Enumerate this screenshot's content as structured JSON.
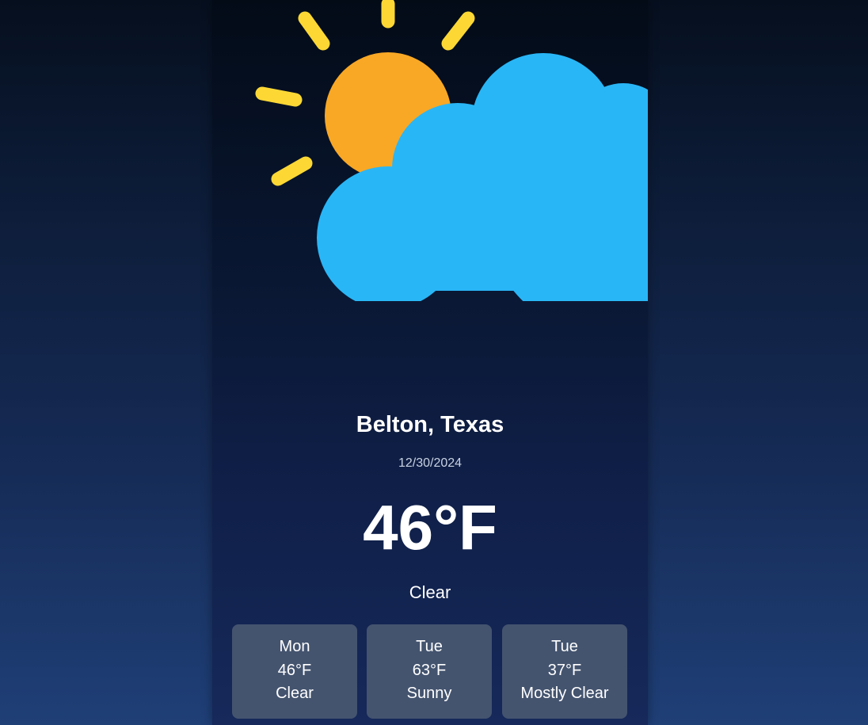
{
  "weather": {
    "location": "Belton, Texas",
    "date": "12/30/2024",
    "temperature": "46°F",
    "condition": "Clear",
    "icon": "partly-cloudy-icon"
  },
  "forecast": [
    {
      "day": "Mon",
      "temp": "46°F",
      "condition": "Clear"
    },
    {
      "day": "Tue",
      "temp": "63°F",
      "condition": "Sunny"
    },
    {
      "day": "Tue",
      "temp": "37°F",
      "condition": "Mostly Clear"
    }
  ],
  "colors": {
    "sun": "#f9a825",
    "sun_rays": "#fdd835",
    "cloud": "#29b6f6",
    "forecast_card": "#44546f"
  }
}
